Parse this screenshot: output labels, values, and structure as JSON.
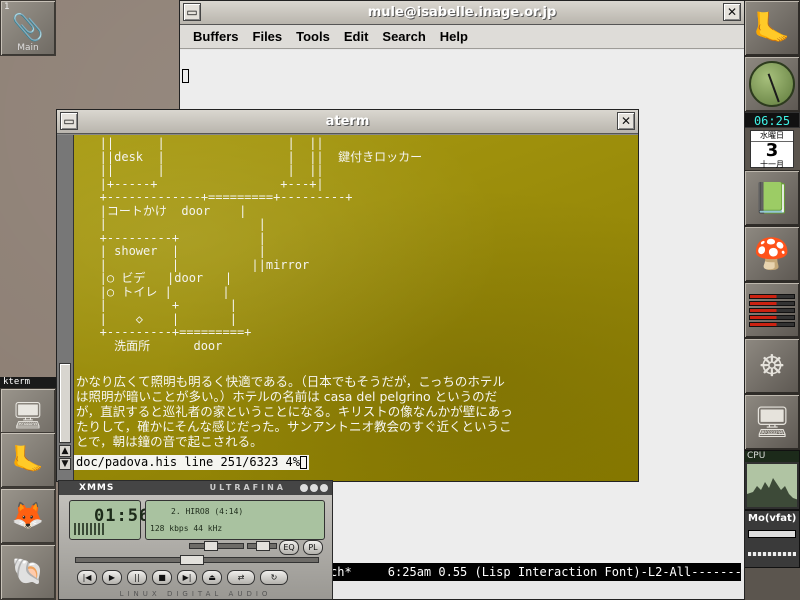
{
  "left_dock": {
    "workspace_number": "1",
    "workspace_label": "Main",
    "kterm_label": "kterm"
  },
  "right_dock": {
    "clock_digital": "06:25",
    "calendar": {
      "day_of_week": "水曜日",
      "day": "3",
      "month": "十一月"
    },
    "cpu_label": "CPU",
    "mount_label": "Mo(vfat)"
  },
  "mule": {
    "title": "mule@isabelle.inage.or.jp",
    "menu": [
      "Buffers",
      "Files",
      "Tools",
      "Edit",
      "Search",
      "Help"
    ],
    "modeline": "ch*     6:25am 0.55 (Lisp Interaction Font)-L2-All----------"
  },
  "aterm": {
    "title": "aterm",
    "diagram_text": "   ||      |                 |  ||\n   ||desk  |                 |  ||  鍵付きロッカー\n   ||      |                 |  ||\n   |+-----+                 +---+|\n   +-------------+=========+---------+\n   |コートかけ  door    |\n   |                     |\n   +---------+           |\n   | shower  |           |\n   |         |          ||mirror\n   |○ ビデ   |door   |\n   |○ トイレ |       |\n   |         +       |\n   |    ◇    |       |\n   +---------+=========+\n     洗面所      door",
    "body_text": "かなり広くて照明も明るく快適である。（日本でもそうだが，こっちのホテル\nは照明が暗いことが多い。）ホテルの名前は casa del pelgrino というのだ\nが，直訳すると巡礼者の家ということになる。キリストの像なんかが壁にあっ\nたりして，確かにそんな感じだった。サンアントニオ教会のすぐ近くというこ\nとで，朝は鐘の音で起こされる。",
    "status_line": "doc/padova.his line 251/6323 4%"
  },
  "xmms": {
    "title": "XMMS",
    "skin_name": "ULTRAFINA",
    "time": "01:56",
    "song": "2. HIRO8 (4:14)",
    "bitrate": "128 kbps  44 kHz",
    "buttons": [
      "|◀",
      "▶",
      "||",
      "■",
      "▶|",
      "⏏"
    ],
    "btn_eq": "EQ",
    "btn_pl": "PL",
    "brand": "LINUX DIGITAL AUDIO"
  }
}
